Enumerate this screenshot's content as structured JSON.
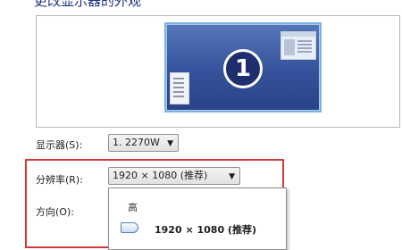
{
  "page": {
    "title": "更改显示器的外观"
  },
  "preview": {
    "monitor_number": "1"
  },
  "display": {
    "label": "显示器(S):",
    "value": "1. 2270W"
  },
  "resolution": {
    "label": "分辨率(R):",
    "value": "1920 × 1080 (推荐)",
    "dropdown": {
      "high_label": "高",
      "selected_label": "1920 × 1080 (推荐)"
    }
  },
  "orientation": {
    "label": "方向(O):"
  }
}
